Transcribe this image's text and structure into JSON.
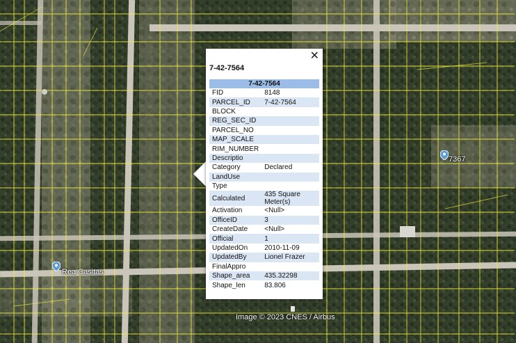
{
  "popup": {
    "title": "7-42-7564",
    "table_header": "7-42-7564",
    "close_symbol": "✕",
    "rows": [
      {
        "key": "FID",
        "value": "8148"
      },
      {
        "key": "PARCEL_ID",
        "value": "7-42-7564"
      },
      {
        "key": "BLOCK",
        "value": ""
      },
      {
        "key": "REG_SEC_ID",
        "value": ""
      },
      {
        "key": "PARCEL_NO",
        "value": ""
      },
      {
        "key": "MAP_SCALE",
        "value": ""
      },
      {
        "key": "RIM_NUMBER",
        "value": ""
      },
      {
        "key": "Descriptio",
        "value": ""
      },
      {
        "key": "Category",
        "value": "Declared"
      },
      {
        "key": "LandUse",
        "value": ""
      },
      {
        "key": "Type",
        "value": ""
      },
      {
        "key": "Calculated",
        "value": "435 Square Meter(s)"
      },
      {
        "key": "Activation",
        "value": "<Null>"
      },
      {
        "key": "OfficeID",
        "value": "3"
      },
      {
        "key": "CreateDate",
        "value": "<Null>"
      },
      {
        "key": "Official",
        "value": "1"
      },
      {
        "key": "UpdatedOn",
        "value": "2010-11-09"
      },
      {
        "key": "UpdatedBy",
        "value": "Lionel Frazer"
      },
      {
        "key": "FinalAppro",
        "value": ""
      },
      {
        "key": "Shape_area",
        "value": "435.32298"
      },
      {
        "key": "Shape_len",
        "value": "83.806"
      }
    ]
  },
  "map": {
    "places": [
      {
        "label": "Rea Casitas",
        "icon": "location-pin-icon"
      },
      {
        "label": "7367",
        "icon": "location-pin-icon"
      }
    ],
    "attribution": "Image © 2023 CNES / Airbus",
    "colors": {
      "parcel_lines": "#f2ef3c",
      "road": "#c9c5b8",
      "vegetation": "#2f3a28",
      "pin": "#5b9bd5"
    }
  }
}
